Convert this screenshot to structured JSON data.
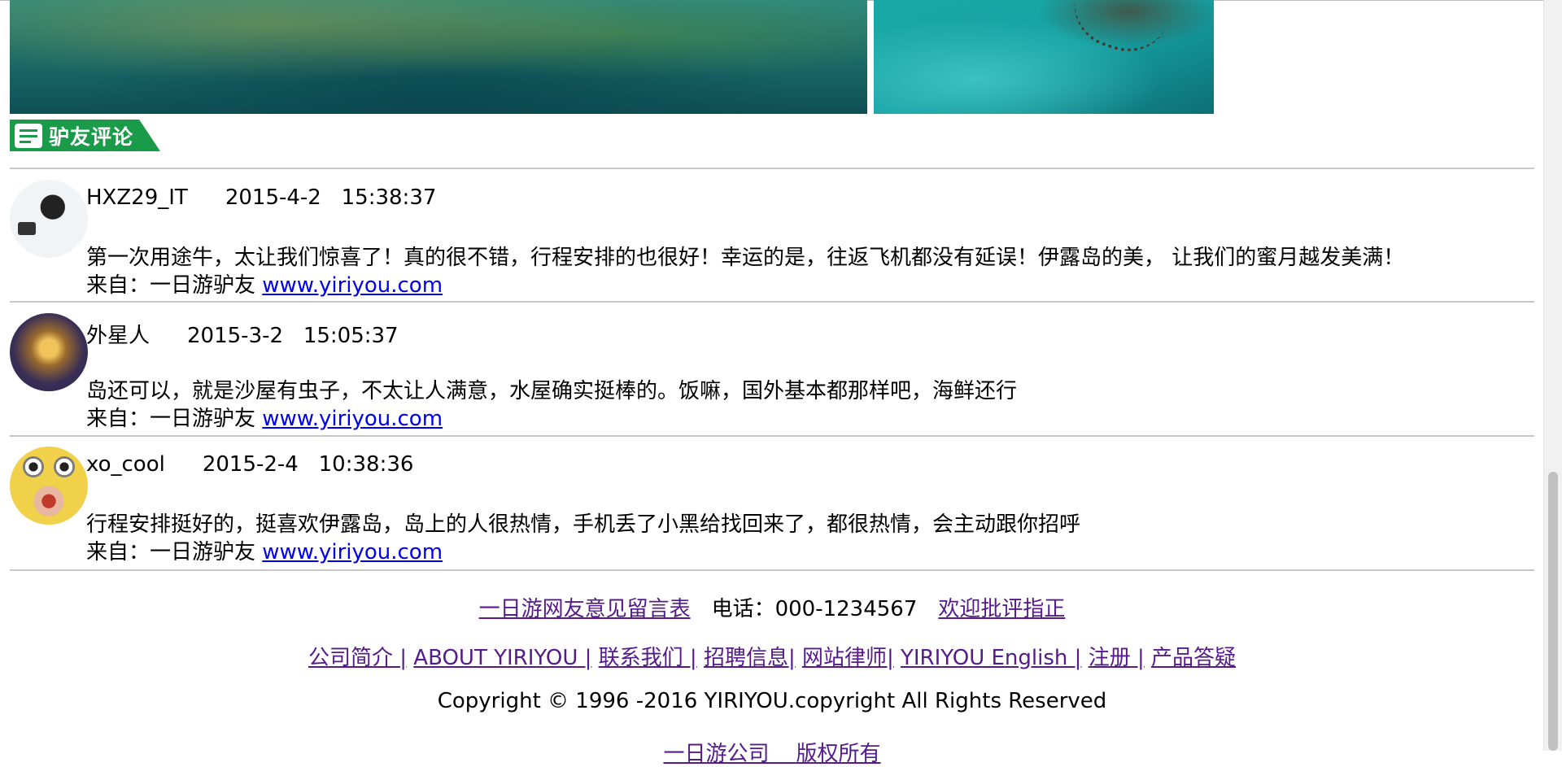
{
  "section_title": "驴友评论",
  "comments": [
    {
      "user": "HXZ29_IT",
      "date": "2015-4-2",
      "time": "15:38:37",
      "text": "第一次用途牛，太让我们惊喜了！真的很不错，行程安排的也很好！幸运的是，往返飞机都没有延误！伊露岛的美， 让我们的蜜月越发美满！",
      "from_label": "来自：一日游驴友",
      "link": "www.yiriyou.com"
    },
    {
      "user": "外星人",
      "date": "2015-3-2",
      "time": "15:05:37",
      "text": "岛还可以，就是沙屋有虫子，不太让人满意，水屋确实挺棒的。饭嘛，国外基本都那样吧，海鲜还行",
      "from_label": "来自：一日游驴友",
      "link": "www.yiriyou.com"
    },
    {
      "user": "xo_cool",
      "date": "2015-2-4",
      "time": "10:38:36",
      "text": "行程安排挺好的，挺喜欢伊露岛，岛上的人很热情，手机丢了小黑给找回来了，都很热情，会主动跟你招呼",
      "from_label": "来自：一日游驴友",
      "link": "www.yiriyou.com"
    }
  ],
  "footer": {
    "feedback_link": "一日游网友意见留言表",
    "phone": "电话：000-1234567",
    "welcome_link": "欢迎批评指正",
    "nav": [
      "公司简介 |",
      "ABOUT YIRIYOU |",
      "联系我们 |",
      "招聘信息|",
      "网站律师|",
      "YIRIYOU English |",
      "注册 |",
      "产品答疑"
    ],
    "copyright": "Copyright © 1996 -2016 YIRIYOU.copyright  All  Rights Reserved",
    "bottom_link": "一日游公司    版权所有"
  },
  "colors": {
    "tag_green": "#1a9b4a",
    "link_blue": "#0000ee",
    "visited_purple": "#551a8b"
  }
}
